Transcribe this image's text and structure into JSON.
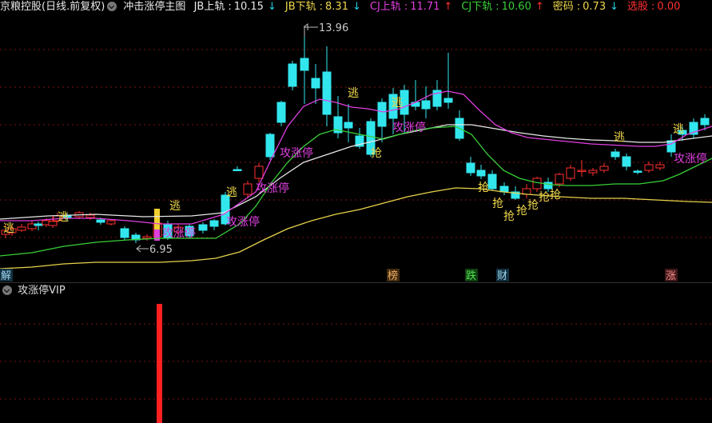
{
  "header": {
    "stock_name": "京粮控股(日线.前复权)",
    "main_indicator": "冲击涨停主图",
    "metrics": [
      {
        "label": "JB上轨",
        "value": "10.15",
        "arrow": "↓",
        "color": "#e8e8e8",
        "arrow_color": "#1fd1e6"
      },
      {
        "label": "JB下轨",
        "value": "8.31",
        "arrow": "↓",
        "color": "#f0d84a",
        "arrow_color": "#1fd1e6"
      },
      {
        "label": "CJ上轨",
        "value": "11.71",
        "arrow": "↑",
        "color": "#e040e0",
        "arrow_color": "#ff3030"
      },
      {
        "label": "CJ下轨",
        "value": "10.60",
        "arrow": "↑",
        "color": "#38d038",
        "arrow_color": "#ff3030"
      },
      {
        "label": "密码",
        "value": "0.73",
        "arrow": "↓",
        "color": "#f0d84a",
        "arrow_color": "#1fd1e6"
      },
      {
        "label": "选股",
        "value": "0.00",
        "arrow": "",
        "color": "#ff3030",
        "arrow_color": "#ff3030"
      }
    ]
  },
  "subpanel": {
    "title": "攻涨停VIP"
  },
  "colors": {
    "up": "#ff3030",
    "down": "#32e6ee",
    "white_line": "#e8e8e8",
    "magenta_line": "#e040e0",
    "green_line": "#38d038",
    "yellow_line": "#e6d24a",
    "signal_text": "#f0d84a",
    "attack_text": "#e040e0",
    "vip_bar": "#ff2020"
  },
  "chart_data": {
    "type": "candlestick",
    "annotations": {
      "high_label": "13.96",
      "low_label": "6.95"
    },
    "signals": {
      "escape": "逃",
      "grab": "抢",
      "attack": "攻涨停"
    },
    "event_tags": [
      {
        "text": "解",
        "color": "#9fd7f0",
        "bg": "#123040"
      },
      {
        "text": "榜",
        "color": "#f0b060",
        "bg": "#402a10"
      },
      {
        "text": "跌",
        "color": "#50e050",
        "bg": "#104010"
      },
      {
        "text": "财",
        "color": "#9fd7f0",
        "bg": "#123040"
      },
      {
        "text": "涨",
        "color": "#ff9090",
        "bg": "#401818"
      }
    ]
  }
}
